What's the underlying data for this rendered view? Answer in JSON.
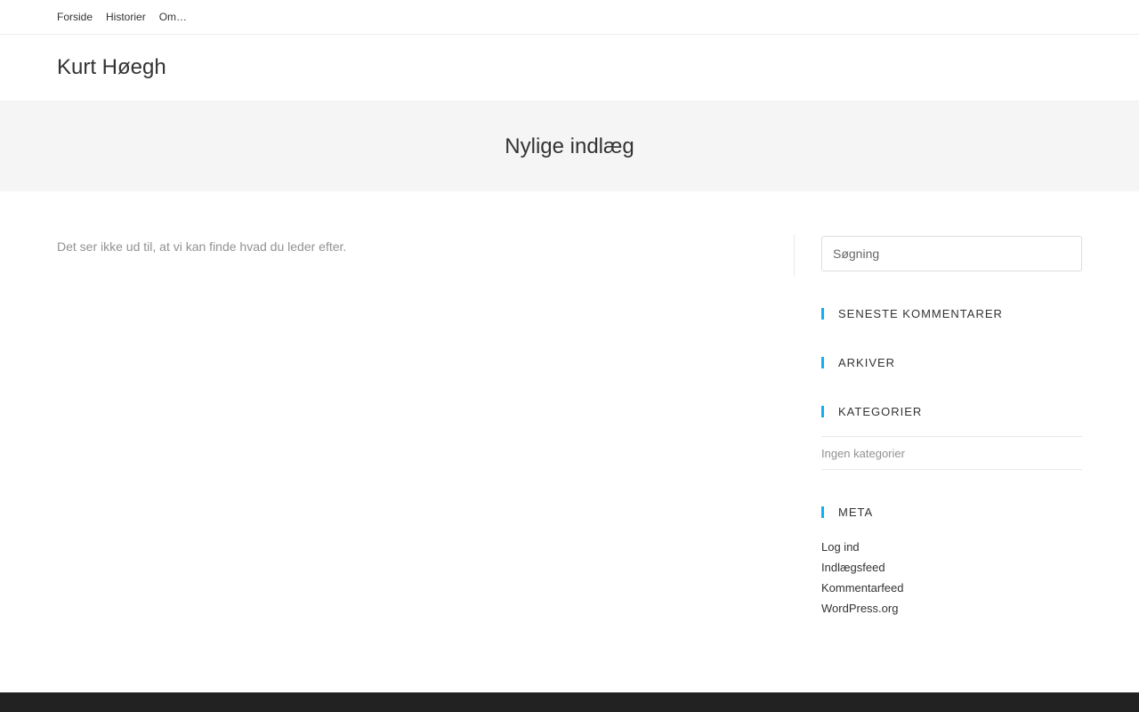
{
  "topnav": {
    "items": [
      {
        "label": "Forside"
      },
      {
        "label": "Historier"
      },
      {
        "label": "Om…"
      }
    ]
  },
  "site": {
    "title": "Kurt Høegh"
  },
  "page": {
    "title": "Nylige indlæg",
    "no_results_text": "Det ser ikke ud til, at vi kan finde hvad du leder efter."
  },
  "sidebar": {
    "search": {
      "placeholder": "Søgning"
    },
    "recent_comments": {
      "title": "Seneste kommentarer"
    },
    "archives": {
      "title": "Arkiver"
    },
    "categories": {
      "title": "Kategorier",
      "empty_text": "Ingen kategorier"
    },
    "meta": {
      "title": "Meta",
      "links": [
        {
          "label": "Log ind"
        },
        {
          "label": "Indlægsfeed"
        },
        {
          "label": "Kommentarfeed"
        },
        {
          "label": "WordPress.org"
        }
      ]
    }
  },
  "colors": {
    "accent": "#13aff0",
    "footer": "#222222",
    "page_header_bg": "#f5f5f5"
  }
}
